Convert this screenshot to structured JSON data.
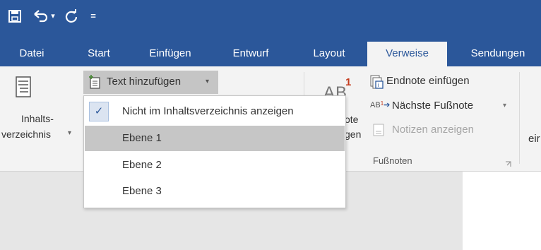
{
  "qat": {
    "save_icon": "save-icon",
    "undo_icon": "undo-icon",
    "redo_icon": "redo-icon",
    "customize_icon": "customize-qat-icon",
    "undo_arrow": "▾",
    "customize_glyph": "="
  },
  "tabs": [
    {
      "label": "Datei",
      "active": false
    },
    {
      "label": "Start",
      "active": false
    },
    {
      "label": "Einfügen",
      "active": false
    },
    {
      "label": "Entwurf",
      "active": false
    },
    {
      "label": "Layout",
      "active": false
    },
    {
      "label": "Verweise",
      "active": true
    },
    {
      "label": "Sendungen",
      "active": false
    }
  ],
  "ribbon": {
    "toc": {
      "label_line1": "Inhalts-",
      "label_line2": "verzeichnis",
      "arrow": "▾"
    },
    "text_hinzufuegen": {
      "label": "Text hinzufügen",
      "arrow": "▾"
    },
    "footnote_big": {
      "superscript": "1",
      "partial_label_1": "ote",
      "partial_label_2": "gen"
    },
    "endnote": {
      "label": "Endnote einfügen"
    },
    "next_footnote": {
      "label": "Nächste Fußnote",
      "arrow": "▾"
    },
    "show_notes": {
      "label": "Notizen anzeigen"
    },
    "group_label": "Fußnoten",
    "partial_right": "eir"
  },
  "dropdown": {
    "items": [
      {
        "label": "Nicht im Inhaltsverzeichnis anzeigen",
        "checked": true,
        "hover": false
      },
      {
        "label": "Ebene 1",
        "checked": false,
        "hover": true
      },
      {
        "label": "Ebene 2",
        "checked": false,
        "hover": false
      },
      {
        "label": "Ebene 3",
        "checked": false,
        "hover": false
      }
    ]
  },
  "colors": {
    "accent": "#2b579a",
    "ribbon_bg": "#f3f3f3",
    "hover_bg": "#c6c6c6",
    "superscript_red": "#c43b1d"
  }
}
